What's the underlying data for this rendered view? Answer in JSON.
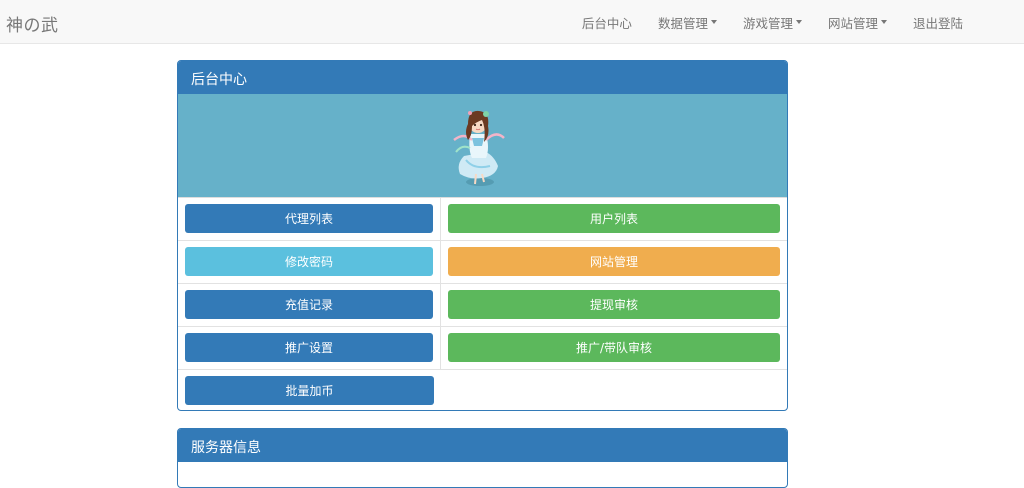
{
  "navbar": {
    "brand": "神の武",
    "items": [
      {
        "label": "后台中心",
        "dropdown": false
      },
      {
        "label": "数据管理",
        "dropdown": true
      },
      {
        "label": "游戏管理",
        "dropdown": true
      },
      {
        "label": "网站管理",
        "dropdown": true
      },
      {
        "label": "退出登陆",
        "dropdown": false
      }
    ]
  },
  "panel_main": {
    "title": "后台中心",
    "buttons": [
      {
        "label": "代理列表"
      },
      {
        "label": "用户列表"
      },
      {
        "label": "修改密码"
      },
      {
        "label": "网站管理"
      },
      {
        "label": "充值记录"
      },
      {
        "label": "提现审核"
      },
      {
        "label": "推广设置"
      },
      {
        "label": "推广/带队审核"
      },
      {
        "label": "批量加币"
      }
    ]
  },
  "panel_server": {
    "title": "服务器信息"
  },
  "colors": {
    "primary": "#337ab7",
    "success": "#5cb85c",
    "info": "#5bc0de",
    "warning": "#f0ad4e",
    "banner": "#66b1c9"
  }
}
